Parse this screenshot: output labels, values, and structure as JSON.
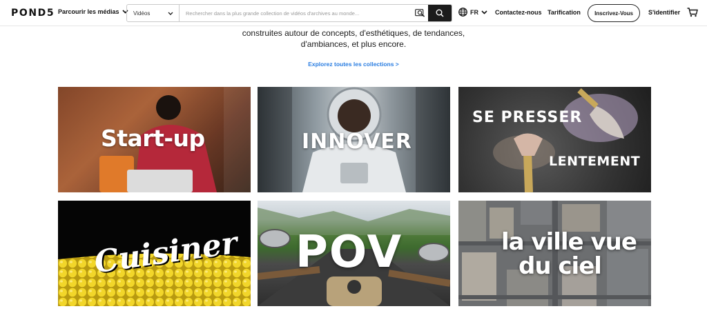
{
  "header": {
    "logo": "POND5",
    "browse_label": "Parcourir les médias",
    "search": {
      "type_value": "Vidéos",
      "placeholder": "Rechercher dans la plus grande collection de vidéos d'archives au monde..."
    },
    "language": "FR",
    "contact_label": "Contactez-nous",
    "pricing_label": "Tarification",
    "signup_label": "Inscrivez-Vous",
    "login_label": "S'identifier"
  },
  "intro": {
    "line1": "construites autour de concepts, d'esthétiques, de tendances,",
    "line2": "d'ambiances, et plus encore.",
    "explore_link": "Explorez toutes les collections >"
  },
  "collections": [
    {
      "label": "Start-up"
    },
    {
      "label": "INNOVER"
    },
    {
      "label_line1": "SE PRESSER",
      "label_line2": "LENTEMENT"
    },
    {
      "label": "Cuisiner"
    },
    {
      "label": "POV"
    },
    {
      "label_line1": "la ville vue",
      "label_line2": "du ciel"
    }
  ],
  "colors": {
    "link": "#2a7de1",
    "text": "#1a1a1a",
    "search_button": "#1b1b1b"
  },
  "icons": [
    "chevron-down-icon",
    "visual-search-icon",
    "search-icon",
    "globe-icon",
    "cart-icon"
  ]
}
